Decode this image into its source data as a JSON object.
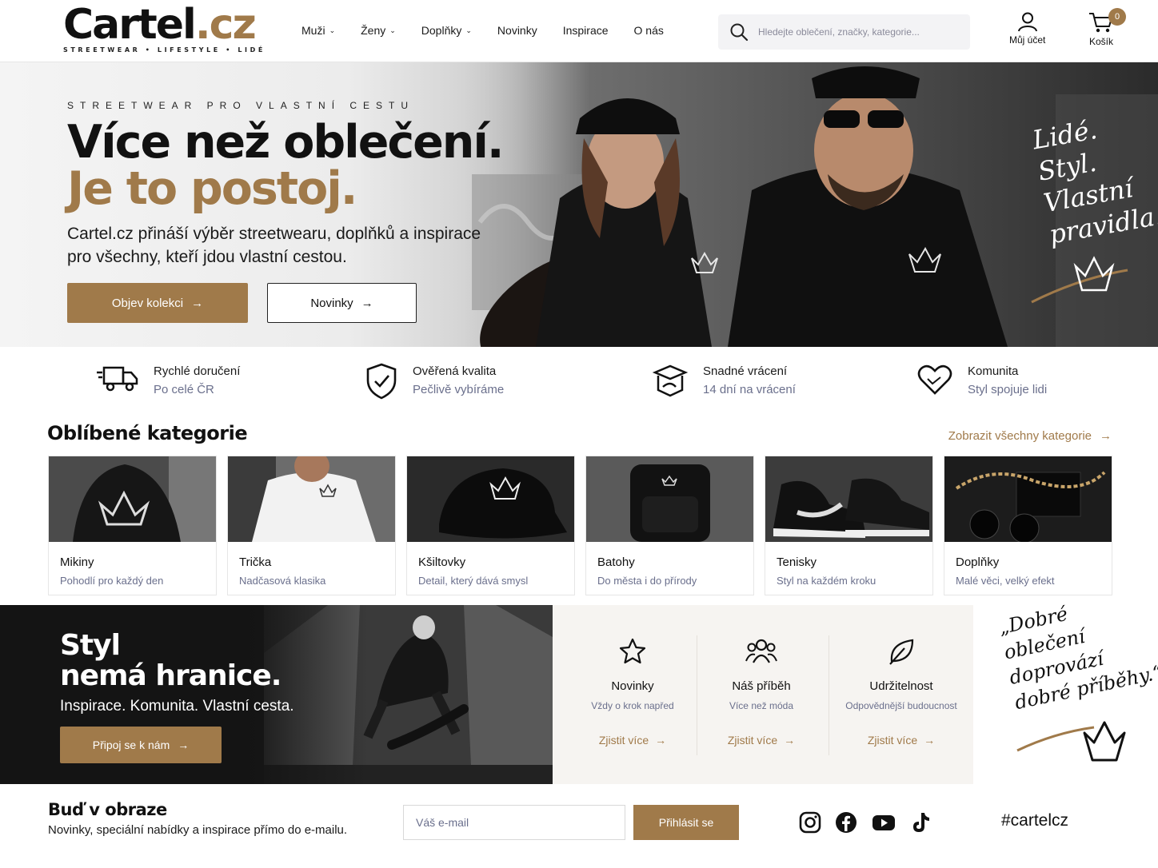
{
  "brand": {
    "name": "Cartel",
    "tld": ".cz",
    "tagline": "STREETWEAR • LIFESTYLE • LIDÉ",
    "accent": "#a07a4a"
  },
  "nav": {
    "items": [
      {
        "label": "Muži",
        "has_dropdown": true
      },
      {
        "label": "Ženy",
        "has_dropdown": true
      },
      {
        "label": "Doplňky",
        "has_dropdown": true
      },
      {
        "label": "Novinky",
        "has_dropdown": false
      },
      {
        "label": "Inspirace",
        "has_dropdown": false
      },
      {
        "label": "O nás",
        "has_dropdown": false
      }
    ]
  },
  "search": {
    "placeholder": "Hledejte oblečení, značky, kategorie..."
  },
  "account": {
    "label": "Můj účet",
    "icon": "user-icon"
  },
  "cart": {
    "label": "Košík",
    "count": "0",
    "icon": "cart-icon"
  },
  "hero": {
    "kicker": "STREETWEAR PRO VLASTNÍ CESTU",
    "title_line1": "Více než oblečení.",
    "title_line2": "Je to postoj.",
    "text": "Cartel.cz přináší výběr streetwearu, doplňků a inspirace pro všechny, kteří jdou vlastní cestou.",
    "primary_cta": "Objev kolekci",
    "secondary_cta": "Novinky",
    "script": [
      "Lidé.",
      "Styl.",
      "Vlastní",
      "pravidla."
    ]
  },
  "features": [
    {
      "title": "Rychlé doručení",
      "subtitle": "Po celé ČR",
      "icon": "delivery-truck-icon"
    },
    {
      "title": "Ověřená kvalita",
      "subtitle": "Pečlivě vybíráme",
      "icon": "shield-check-icon"
    },
    {
      "title": "Snadné vrácení",
      "subtitle": "14 dní na vrácení",
      "icon": "return-box-icon"
    },
    {
      "title": "Komunita",
      "subtitle": "Styl spojuje lidi",
      "icon": "heart-icon"
    }
  ],
  "categories": {
    "title": "Oblíbené kategorie",
    "view_all": "Zobrazit všechny kategorie",
    "items": [
      {
        "name": "Mikiny",
        "desc": "Pohodlí pro každý den"
      },
      {
        "name": "Trička",
        "desc": "Nadčasová klasika"
      },
      {
        "name": "Kšiltovky",
        "desc": "Detail, který dává smysl"
      },
      {
        "name": "Batohy",
        "desc": "Do města i do přírody"
      },
      {
        "name": "Tenisky",
        "desc": "Styl na každém kroku"
      },
      {
        "name": "Doplňky",
        "desc": "Malé věci, velký efekt"
      }
    ]
  },
  "promo": {
    "title_line1": "Styl",
    "title_line2": "nemá hranice.",
    "text": "Inspirace. Komunita. Vlastní cesta.",
    "cta": "Připoj se k nám"
  },
  "info": [
    {
      "title": "Novinky",
      "subtitle": "Vždy o krok napřed",
      "link": "Zjistit více",
      "icon": "star-icon"
    },
    {
      "title": "Náš příběh",
      "subtitle": "Více než móda",
      "link": "Zjistit více",
      "icon": "people-icon"
    },
    {
      "title": "Udržitelnost",
      "subtitle": "Odpovědnější budoucnost",
      "link": "Zjistit více",
      "icon": "leaf-icon"
    }
  ],
  "quote": [
    "„Dobré",
    "oblečení",
    "doprovází",
    "dobré příběhy.“"
  ],
  "newsletter": {
    "title": "Buď v obraze",
    "subtitle": "Novinky, speciální nabídky a inspirace přímo do e-mailu.",
    "placeholder": "Váš e-mail",
    "button": "Přihlásit se"
  },
  "social": {
    "icons": [
      "instagram-icon",
      "facebook-icon",
      "youtube-icon",
      "tiktok-icon"
    ],
    "hashtag": "#cartelcz"
  }
}
